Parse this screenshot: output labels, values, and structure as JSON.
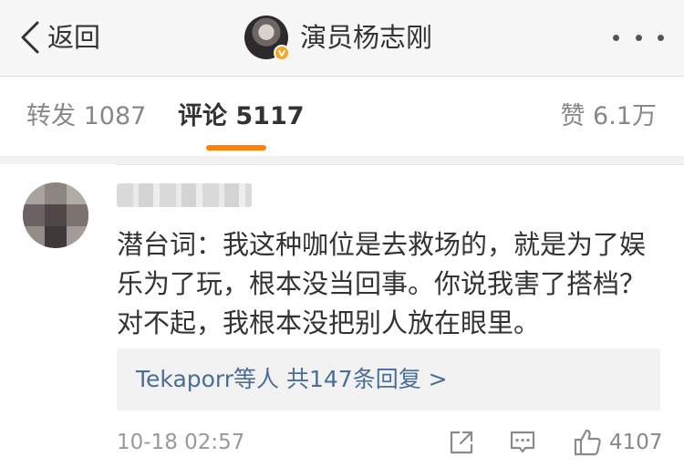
{
  "nav": {
    "back_label": "返回",
    "account_name": "演员杨志刚",
    "back_icon": "chevron-left-icon",
    "more_icon": "more-horizontal-icon",
    "verified_badge_color": "#f5a623"
  },
  "tabs": [
    {
      "label": "转发 1087",
      "active": false
    },
    {
      "label": "评论 5117",
      "active": true
    },
    {
      "label": "赞 6.1万",
      "active": false
    }
  ],
  "accent_color": "#ff8200",
  "comment": {
    "text": "潜台词：我这种咖位是去救场的，就是为了娱乐为了玩，根本没当回事。你说我害了搭档？对不起，我根本没把别人放在眼里。",
    "replies_summary": "Tekaporr等人  共147条回复 >",
    "time": "10-18 02:57",
    "like_count": "4107",
    "icons": [
      "share-icon",
      "comment-icon",
      "thumbs-up-icon"
    ],
    "link_color": "#4a6e97"
  }
}
